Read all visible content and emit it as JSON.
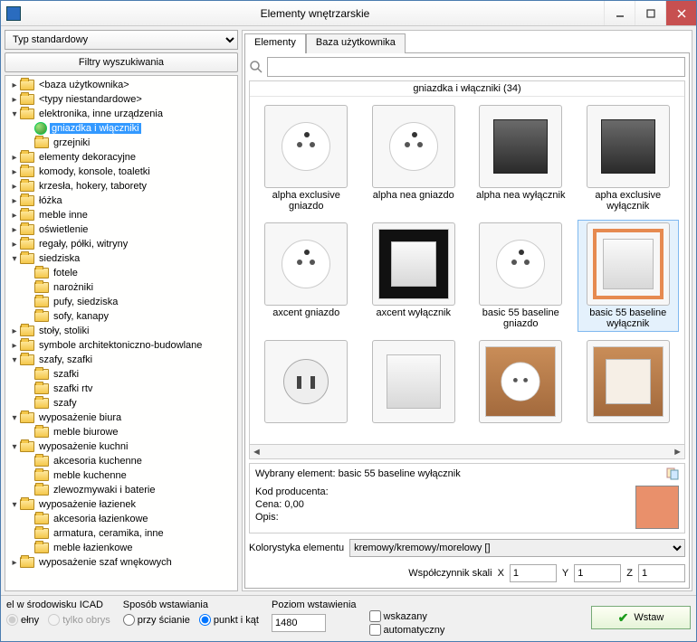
{
  "window": {
    "title": "Elementy wnętrzarskie"
  },
  "left": {
    "type_select": "Typ standardowy",
    "filter_btn": "Filtry wyszukiwania",
    "tree": [
      {
        "d": 0,
        "exp": "▸",
        "label": "<baza użytkownika>"
      },
      {
        "d": 0,
        "exp": "▸",
        "label": "<typy niestandardowe>"
      },
      {
        "d": 0,
        "exp": "▾",
        "label": "elektronika, inne urządzenia"
      },
      {
        "d": 1,
        "exp": "",
        "icon": "globe",
        "label": "gniazdka i włączniki",
        "sel": true
      },
      {
        "d": 1,
        "exp": "",
        "label": "grzejniki"
      },
      {
        "d": 0,
        "exp": "▸",
        "label": "elementy dekoracyjne"
      },
      {
        "d": 0,
        "exp": "▸",
        "label": "komody, konsole, toaletki"
      },
      {
        "d": 0,
        "exp": "▸",
        "label": "krzesła, hokery, taborety"
      },
      {
        "d": 0,
        "exp": "▸",
        "label": "łóżka"
      },
      {
        "d": 0,
        "exp": "▸",
        "label": "meble inne"
      },
      {
        "d": 0,
        "exp": "▸",
        "label": "oświetlenie"
      },
      {
        "d": 0,
        "exp": "▸",
        "label": "regały, półki, witryny"
      },
      {
        "d": 0,
        "exp": "▾",
        "label": "siedziska"
      },
      {
        "d": 1,
        "exp": "",
        "label": "fotele"
      },
      {
        "d": 1,
        "exp": "",
        "label": "narożniki"
      },
      {
        "d": 1,
        "exp": "",
        "label": "pufy, siedziska"
      },
      {
        "d": 1,
        "exp": "",
        "label": "sofy, kanapy"
      },
      {
        "d": 0,
        "exp": "▸",
        "label": "stoły, stoliki"
      },
      {
        "d": 0,
        "exp": "▸",
        "label": "symbole architektoniczno-budowlane"
      },
      {
        "d": 0,
        "exp": "▾",
        "label": "szafy, szafki"
      },
      {
        "d": 1,
        "exp": "",
        "label": "szafki"
      },
      {
        "d": 1,
        "exp": "",
        "label": "szafki rtv"
      },
      {
        "d": 1,
        "exp": "",
        "label": "szafy"
      },
      {
        "d": 0,
        "exp": "▾",
        "label": "wyposażenie biura"
      },
      {
        "d": 1,
        "exp": "",
        "label": "meble biurowe"
      },
      {
        "d": 0,
        "exp": "▾",
        "label": "wyposażenie kuchni"
      },
      {
        "d": 1,
        "exp": "",
        "label": "akcesoria kuchenne"
      },
      {
        "d": 1,
        "exp": "",
        "label": "meble kuchenne"
      },
      {
        "d": 1,
        "exp": "",
        "label": "zlewozmywaki i baterie"
      },
      {
        "d": 0,
        "exp": "▾",
        "label": "wyposażenie łazienek"
      },
      {
        "d": 1,
        "exp": "",
        "label": "akcesoria łazienkowe"
      },
      {
        "d": 1,
        "exp": "",
        "label": "armatura, ceramika, inne"
      },
      {
        "d": 1,
        "exp": "",
        "label": "meble łazienkowe"
      },
      {
        "d": 0,
        "exp": "▸",
        "label": "wyposażenie szaf wnękowych"
      }
    ]
  },
  "tabs": {
    "t0": "Elementy",
    "t1": "Baza użytkownika"
  },
  "grid": {
    "title": "gniazdka i włączniki (34)",
    "items": [
      {
        "cap": "alpha exclusive gniazdo",
        "kind": "socket"
      },
      {
        "cap": "alpha nea gniazdo",
        "kind": "socket"
      },
      {
        "cap": "alpha nea wyłącznik",
        "kind": "switch-dark"
      },
      {
        "cap": "apha exclusive wyłącznik",
        "kind": "switch-dark"
      },
      {
        "cap": "axcent gniazdo",
        "kind": "socket"
      },
      {
        "cap": "axcent wyłącznik",
        "kind": "switch-black"
      },
      {
        "cap": "basic 55 baseline gniazdo",
        "kind": "socket"
      },
      {
        "cap": "basic 55 baseline wyłącznik",
        "kind": "switch-orange",
        "sel": true
      },
      {
        "cap": "",
        "kind": "schuko"
      },
      {
        "cap": "",
        "kind": "switch"
      },
      {
        "cap": "",
        "kind": "socket-copper"
      },
      {
        "cap": "",
        "kind": "switch-copper"
      }
    ]
  },
  "info": {
    "sel_label": "Wybrany element: basic 55 baseline wyłącznik",
    "kod": "Kod producenta:",
    "cena": "Cena: 0,00",
    "opis": "Opis:",
    "kol_label": "Kolorystyka elementu",
    "kol_value": "kremowy/kremowy/morelowy []",
    "scale_label": "Współczynnik skali",
    "x": "1",
    "y": "1",
    "z": "1"
  },
  "bottom": {
    "env": "el w środowisku ICAD",
    "full": "ełny",
    "outline": "tylko obrys",
    "mode_h": "Sposób wstawiania",
    "mode_wall": "przy ścianie",
    "mode_point": "punkt i kąt",
    "level_h": "Poziom wstawienia",
    "level_v": "1480",
    "chk1": "wskazany",
    "chk2": "automatyczny",
    "insert": "Wstaw"
  }
}
